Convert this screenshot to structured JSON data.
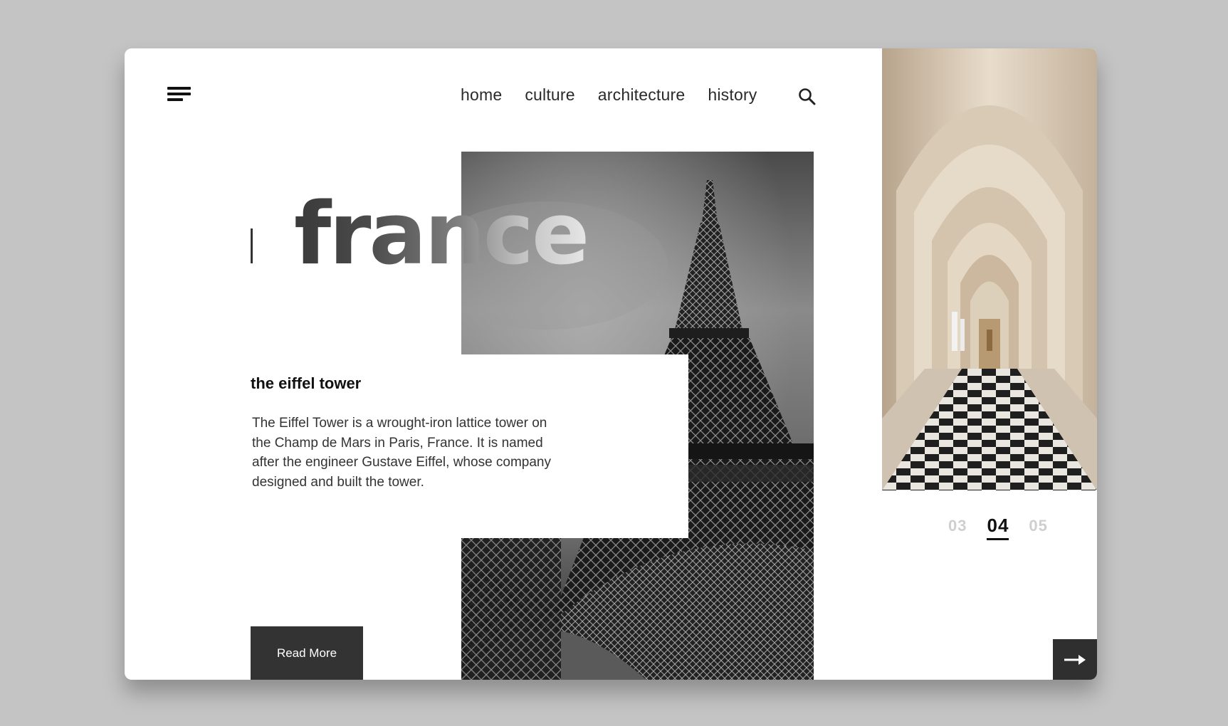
{
  "nav": {
    "items": [
      {
        "label": "home"
      },
      {
        "label": "culture"
      },
      {
        "label": "architecture"
      },
      {
        "label": "history"
      }
    ]
  },
  "hero": {
    "title": "france",
    "subtitle": "the eiffel tower",
    "description": "The Eiffel Tower is a wrought-iron lattice tower on the Champ de Mars in Paris, France. It is named after the engineer Gustave Eiffel, whose company designed and built the tower.",
    "button_label": "Read More"
  },
  "pager": {
    "prev": "03",
    "current": "04",
    "next": "05"
  },
  "icons": {
    "menu": "menu-icon",
    "search": "search-icon",
    "next": "arrow-right-icon"
  },
  "colors": {
    "background": "#c4c4c4",
    "card": "#ffffff",
    "dark_button": "#333333",
    "text_primary": "#111111",
    "pager_dim": "#cfcfcf"
  }
}
